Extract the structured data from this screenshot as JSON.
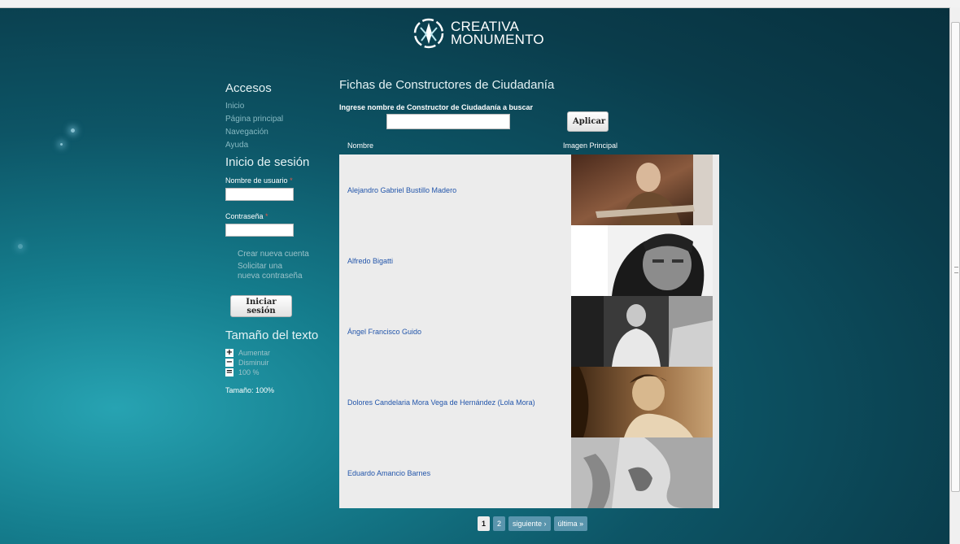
{
  "logo": {
    "line1": "CREATIVA",
    "line2": "MONUMENTO"
  },
  "colors": {
    "accent": "#2255aa",
    "bg_dark": "#0a3c4b",
    "bg_light": "#27a3b2",
    "required": "#e05a4a"
  },
  "sidebar": {
    "accesos_title": "Accesos",
    "nav": [
      {
        "label": "Inicio"
      },
      {
        "label": "Página principal"
      },
      {
        "label": "Navegación"
      },
      {
        "label": "Ayuda"
      }
    ],
    "login_title": "Inicio de sesión",
    "username_label": "Nombre de usuario",
    "password_label": "Contraseña",
    "required_mark": "*",
    "create_account": "Crear nueva cuenta",
    "request_password": "Solicitar una nueva contraseña",
    "login_button": "Iniciar sesión",
    "text_size_title": "Tamaño del texto",
    "text_size": [
      {
        "icon": "plus-icon",
        "glyph": "+",
        "label": "Aumentar"
      },
      {
        "icon": "minus-icon",
        "glyph": "−",
        "label": "Disminuir"
      },
      {
        "icon": "equals-icon",
        "glyph": "=",
        "label": "100 %"
      }
    ],
    "current_size": "Tamaño: 100%"
  },
  "main": {
    "title": "Fichas de Constructores de Ciudadanía",
    "search_label": "Ingrese nombre de Constructor de Ciudadanía a buscar",
    "search_value": "",
    "apply_button": "Aplicar",
    "columns": {
      "name": "Nombre",
      "image": "Imagen Principal"
    },
    "rows": [
      {
        "name": "Alejandro Gabriel Bustillo Madero"
      },
      {
        "name": "Alfredo Bigatti"
      },
      {
        "name": "Ángel Francisco Guido"
      },
      {
        "name": "Dolores Candelaria Mora Vega de Hernández (Lola Mora)"
      },
      {
        "name": "Eduardo Amancio Barnes"
      }
    ]
  },
  "pager": {
    "current": "1",
    "page2": "2",
    "next": "siguiente ›",
    "last": "última »"
  }
}
